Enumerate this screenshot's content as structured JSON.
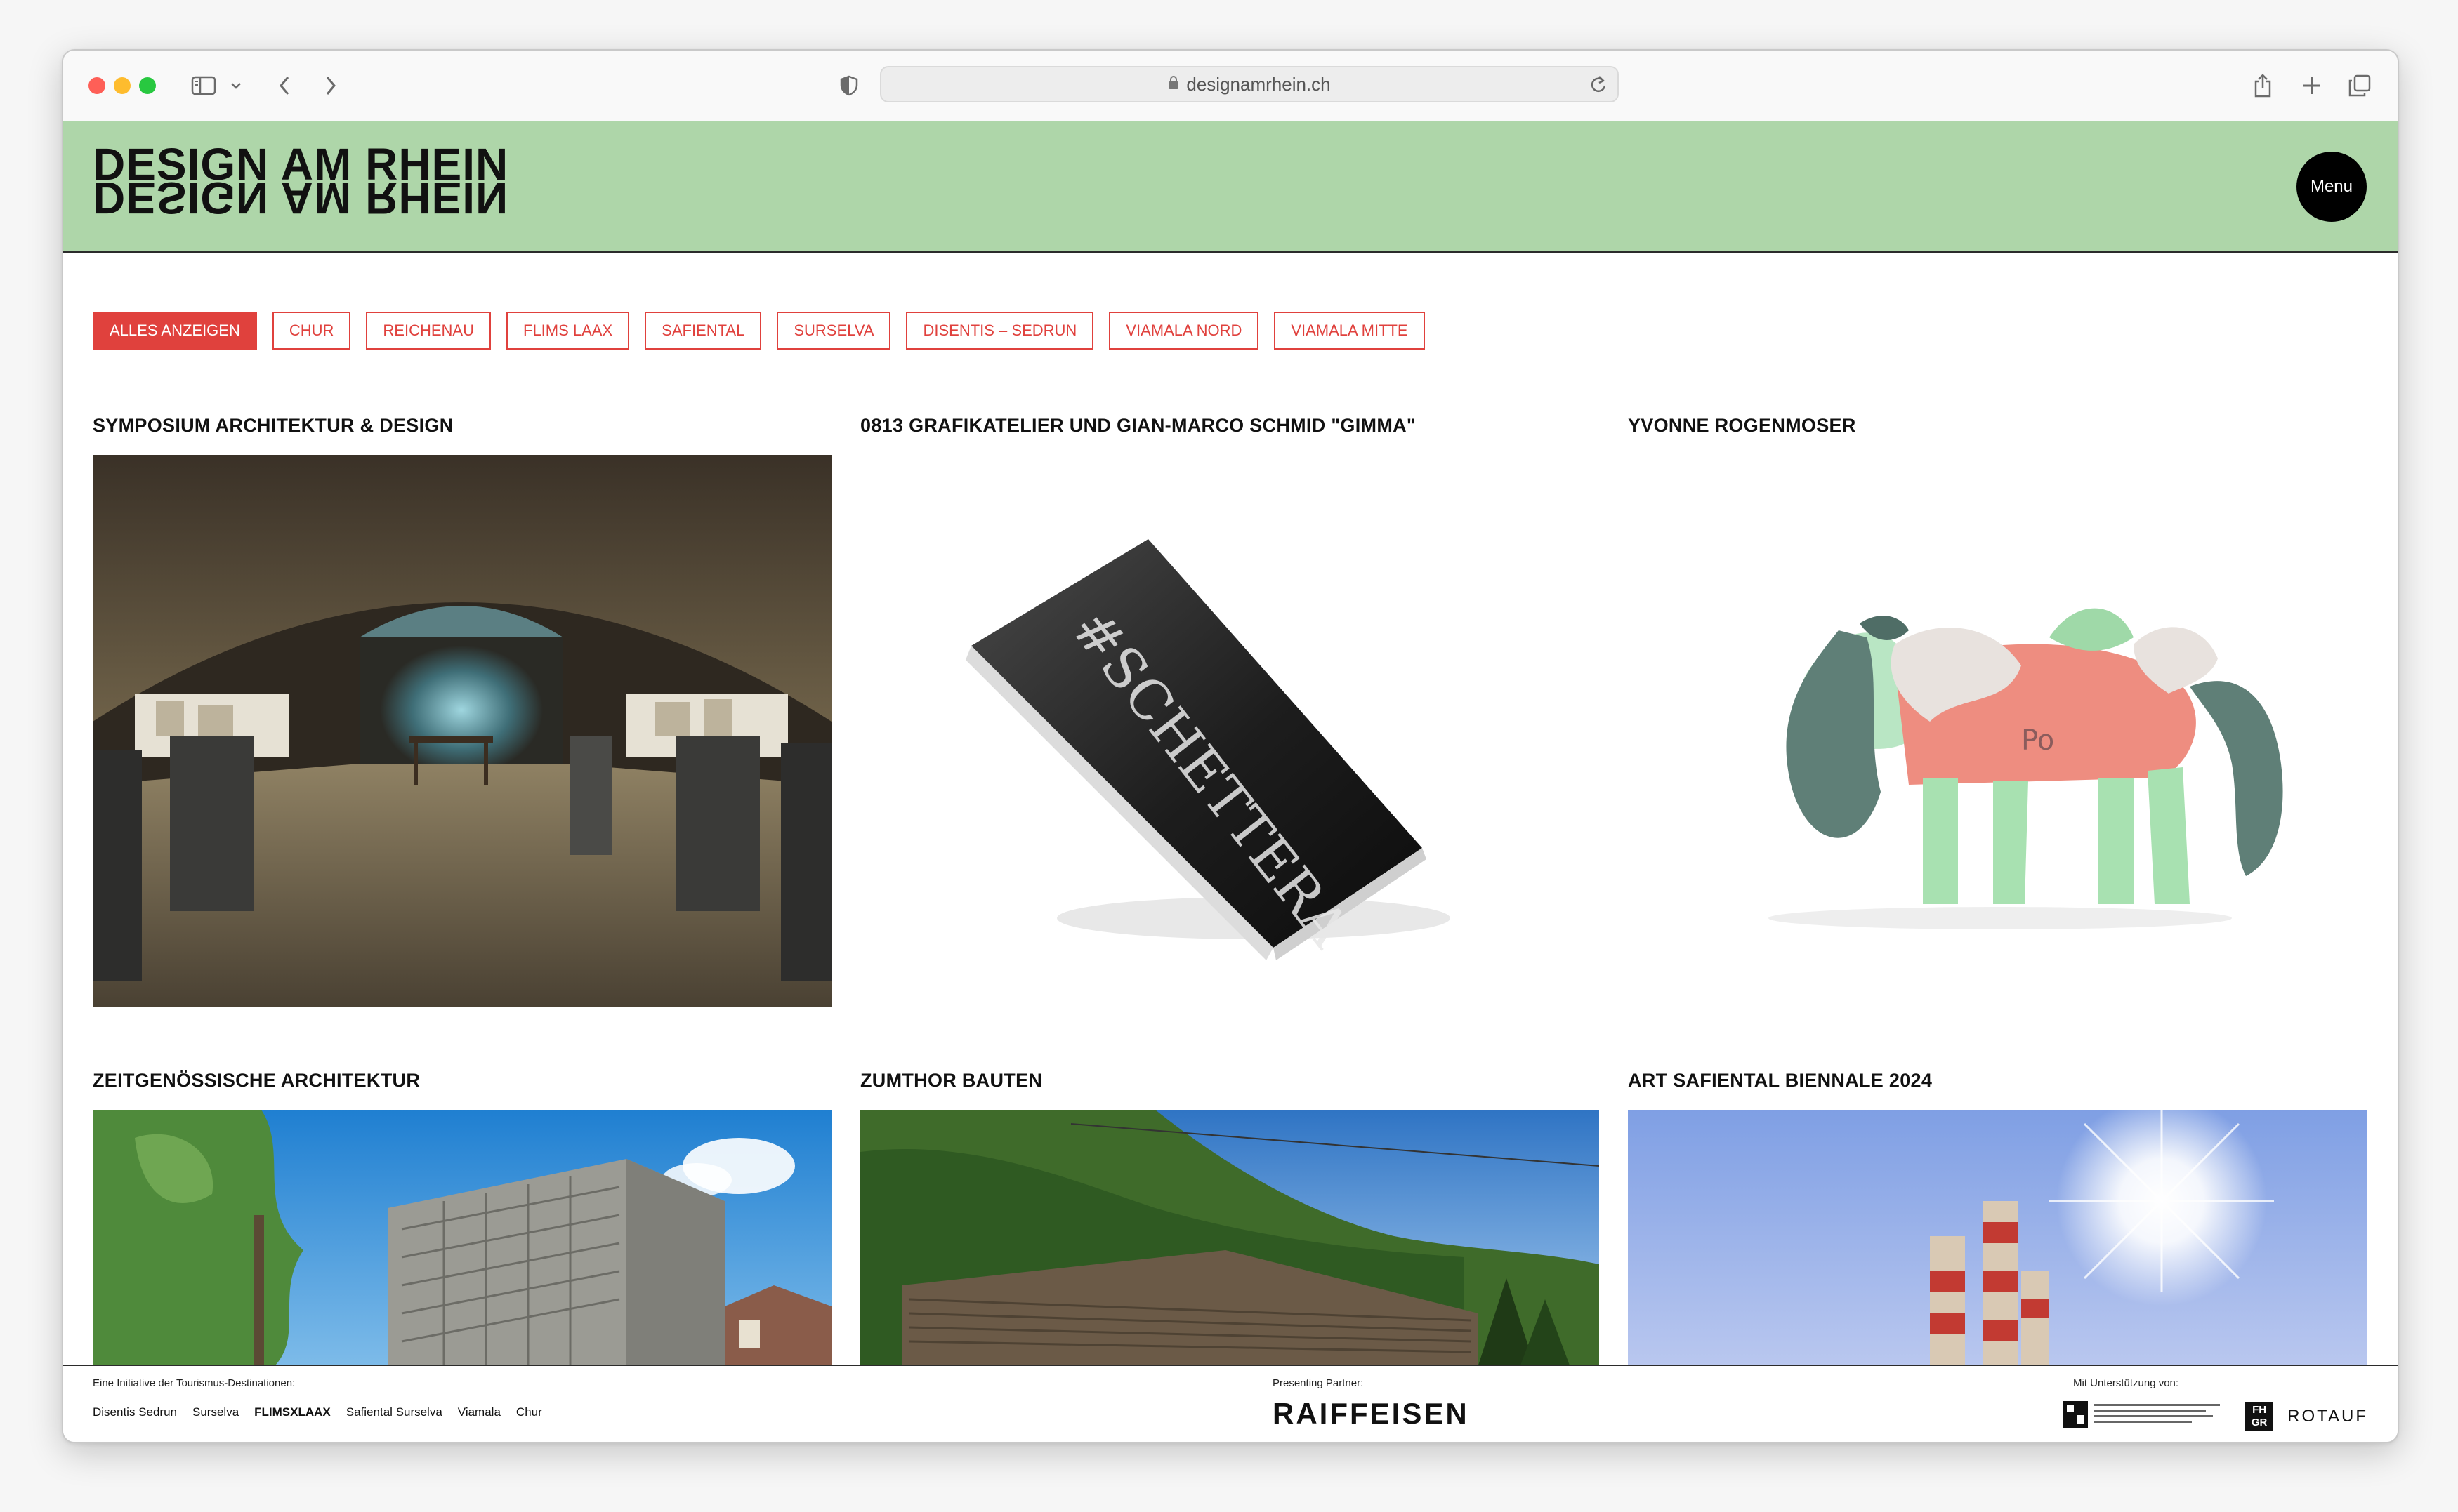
{
  "browser": {
    "url": "designamrhein.ch"
  },
  "site": {
    "logo": "DESIGN AM RHEIN",
    "menu_label": "Menu"
  },
  "filters": [
    {
      "label": "ALLES ANZEIGEN",
      "active": true
    },
    {
      "label": "CHUR",
      "active": false
    },
    {
      "label": "REICHENAU",
      "active": false
    },
    {
      "label": "FLIMS LAAX",
      "active": false
    },
    {
      "label": "SAFIENTAL",
      "active": false
    },
    {
      "label": "SURSELVA",
      "active": false
    },
    {
      "label": "DISENTIS – SEDRUN",
      "active": false
    },
    {
      "label": "VIAMALA NORD",
      "active": false
    },
    {
      "label": "VIAMALA MITTE",
      "active": false
    }
  ],
  "cards": [
    {
      "title": "SYMPOSIUM ARCHITEKTUR & DESIGN",
      "image": "vaulted-cellar-exhibition-photo"
    },
    {
      "title": "0813 GRAFIKATELIER UND GIAN-MARCO SCHMID \"GIMMA\"",
      "image": "black-book-mockup",
      "book_text": "#SCHETTERA"
    },
    {
      "title": "YVONNE ROGENMOSER",
      "image": "ceramic-pony-sculpture",
      "sculpture_text": "Po"
    },
    {
      "title": "ZEITGENÖSSISCHE ARCHITEKTUR",
      "image": "concrete-grid-building-photo"
    },
    {
      "title": "ZUMTHOR BAUTEN",
      "image": "wooden-building-mountain-photo"
    },
    {
      "title": "ART SAFIENTAL BIENNALE 2024",
      "image": "striped-pillars-sun-photo"
    }
  ],
  "footer": {
    "initiative_label": "Eine Initiative der Tourismus-Destinationen:",
    "destinations": [
      "Disentis Sedrun",
      "Surselva",
      "FLIMSXLAAX",
      "Safiental Surselva",
      "Viamala",
      "Chur"
    ],
    "partner_label": "Presenting Partner:",
    "partner_name": "RAIFFEISEN",
    "support_label": "Mit Unterstützung von:",
    "support_fhgr": "FH GR",
    "support_rotauf": "ROTAUF"
  }
}
